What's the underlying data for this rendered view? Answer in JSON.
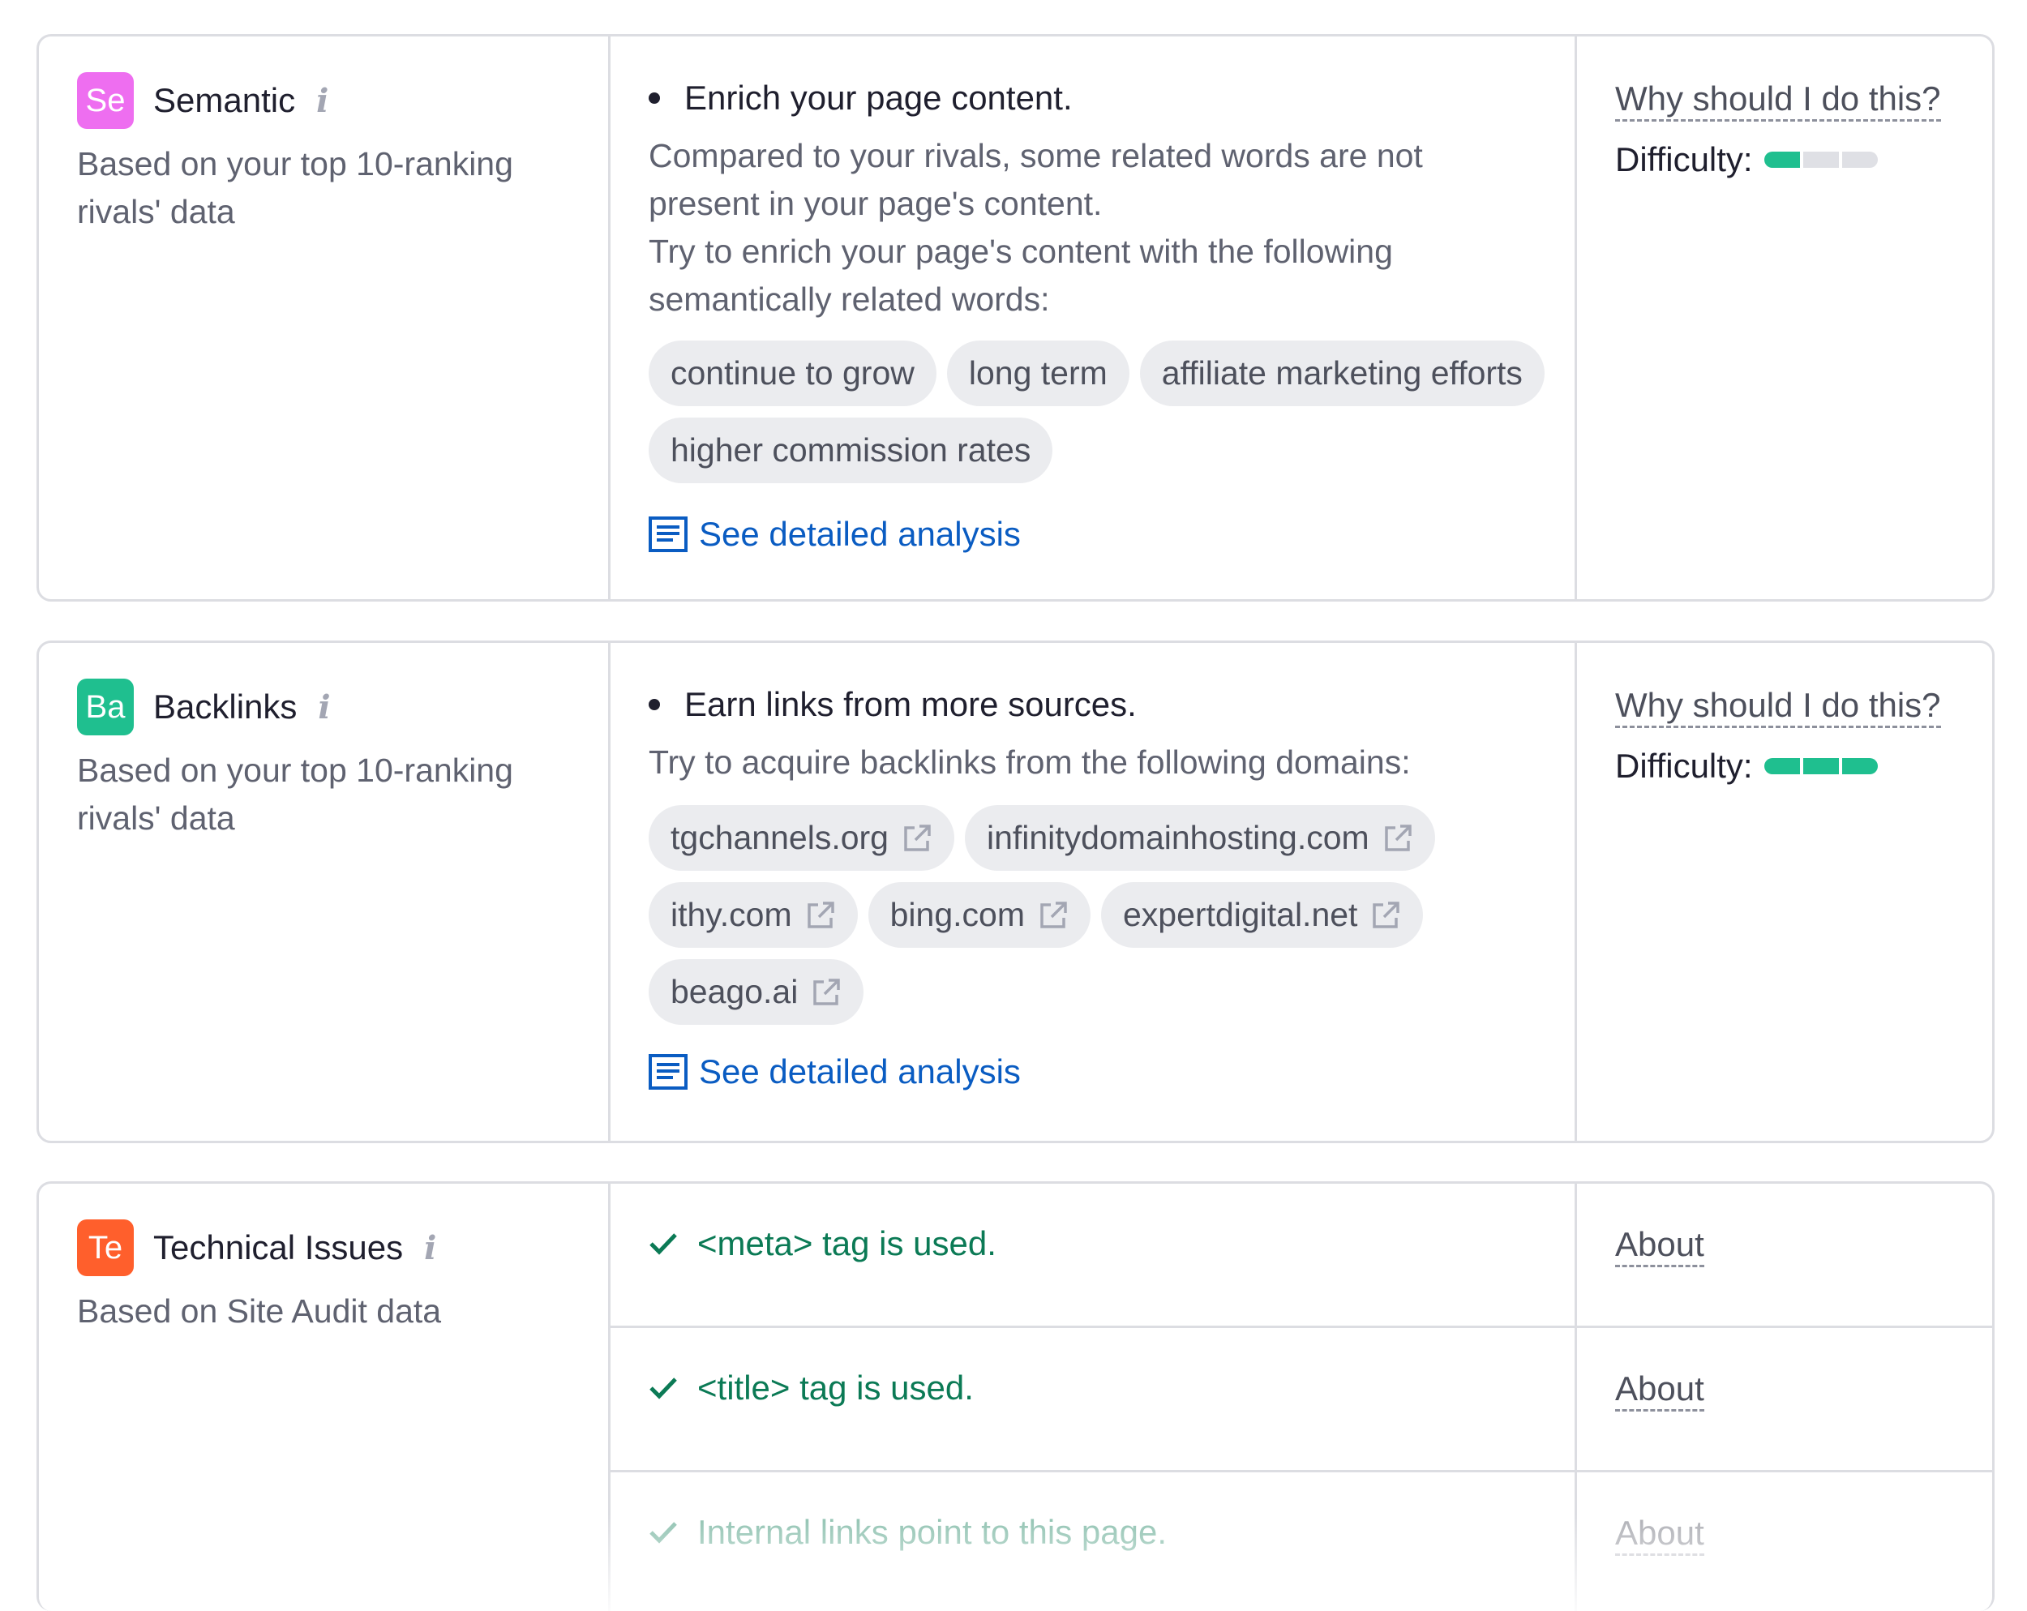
{
  "semantic": {
    "badge": "Se",
    "title": "Semantic",
    "subtitle": "Based on your top 10-ranking rivals' data",
    "headline": "Enrich your page content.",
    "desc_line1": "Compared to your rivals, some related words are not present in your page's content.",
    "desc_line2": "Try to enrich your page's content with the following semantically related words:",
    "pills": [
      "continue to grow",
      "long term",
      "affiliate marketing efforts",
      "higher commission rates"
    ],
    "link": "See detailed analysis",
    "why": "Why should I do this?",
    "difficulty_label": "Difficulty:",
    "difficulty_level": 1,
    "difficulty_max": 3
  },
  "backlinks": {
    "badge": "Ba",
    "title": "Backlinks",
    "subtitle": "Based on your top 10-ranking rivals' data",
    "headline": "Earn links from more sources.",
    "desc": "Try to acquire backlinks from the following domains:",
    "domains": [
      "tgchannels.org",
      "infinitydomainhosting.com",
      "ithy.com",
      "bing.com",
      "expertdigital.net",
      "beago.ai"
    ],
    "link": "See detailed analysis",
    "why": "Why should I do this?",
    "difficulty_label": "Difficulty:",
    "difficulty_level": 3,
    "difficulty_max": 3
  },
  "technical": {
    "badge": "Te",
    "title": "Technical Issues",
    "subtitle": "Based on Site Audit data",
    "checks": [
      {
        "text": "<meta> tag is used.",
        "about": "About"
      },
      {
        "text": "<title> tag is used.",
        "about": "About"
      },
      {
        "text": "Internal links point to this page.",
        "about": "About"
      }
    ]
  },
  "colors": {
    "semantic_badge": "#ee6ef0",
    "backlinks_badge": "#1fbf8f",
    "technical_badge": "#ff5f2c",
    "link_blue": "#0a5cc2",
    "check_green": "#0b7a55",
    "difficulty_green": "#1fbf8f"
  },
  "icons": {
    "info": "info-icon",
    "external": "external-link-icon",
    "analysis": "document-icon",
    "check": "checkmark-icon"
  }
}
